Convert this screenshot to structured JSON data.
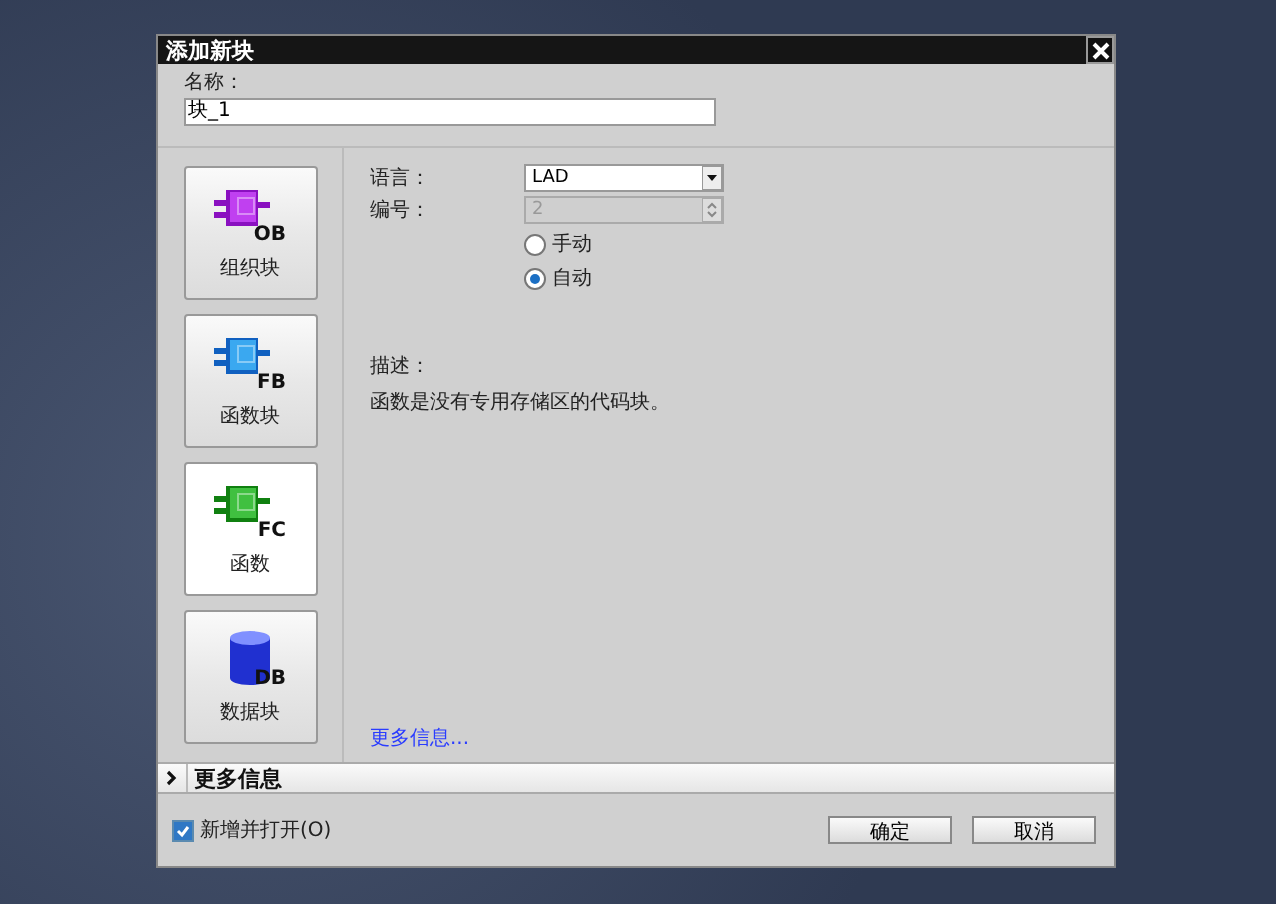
{
  "dialog": {
    "title": "添加新块"
  },
  "name_field": {
    "label": "名称：",
    "value": "块_1"
  },
  "blocks": [
    {
      "kind": "ob",
      "badge": "OB",
      "label": "组织块",
      "selected": false
    },
    {
      "kind": "fb",
      "badge": "FB",
      "label": "函数块",
      "selected": false
    },
    {
      "kind": "fc",
      "badge": "FC",
      "label": "函数",
      "selected": true
    },
    {
      "kind": "db",
      "badge": "DB",
      "label": "数据块",
      "selected": false
    }
  ],
  "language": {
    "label": "语言：",
    "value": "LAD"
  },
  "number": {
    "label": "编号：",
    "value": "2",
    "disabled": true
  },
  "numbering_mode": [
    {
      "label": "手动",
      "selected": false
    },
    {
      "label": "自动",
      "selected": true
    }
  ],
  "description": {
    "label": "描述：",
    "text": "函数是没有专用存储区的代码块。"
  },
  "more_info_link": "更多信息...",
  "more_info_section": {
    "label": "更多信息",
    "expanded": false
  },
  "open_after_add": {
    "label": "新增并打开(O)",
    "checked": true
  },
  "buttons": [
    "确定",
    "取消"
  ]
}
